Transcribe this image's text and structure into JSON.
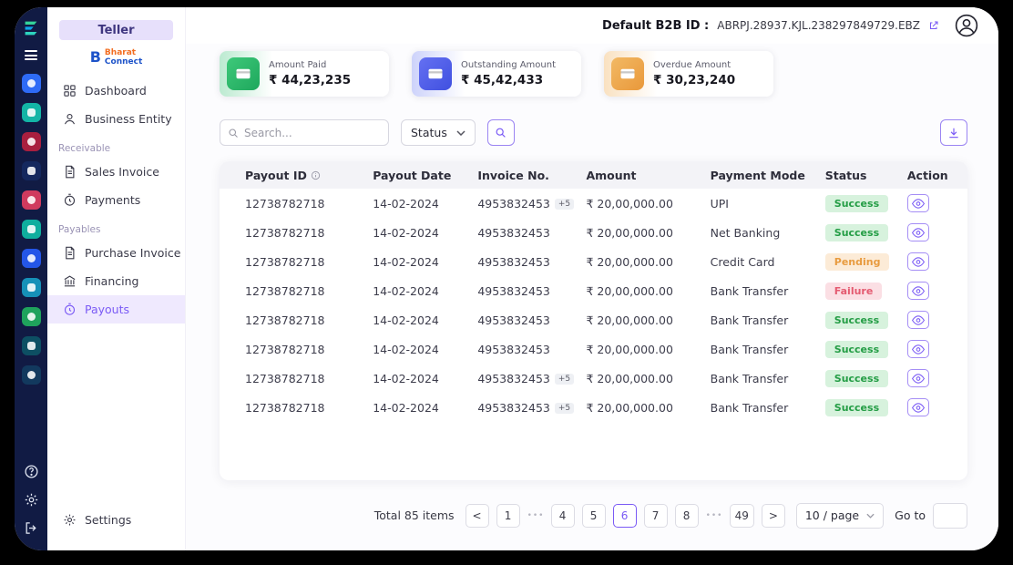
{
  "topbar": {
    "b2b_label": "Default B2B ID :",
    "b2b_value": "ABRPJ.28937.KJL.238297849729.EBZ"
  },
  "sidebar": {
    "title": "Teller",
    "brand_mark": "B",
    "brand_line1": "Bharat",
    "brand_line2": "Connect",
    "section_receivable": "Receivable",
    "section_payables": "Payables",
    "items": {
      "dashboard": "Dashboard",
      "business_entity": "Business Entity",
      "sales_invoice": "Sales Invoice",
      "payments": "Payments",
      "purchase_invoice": "Purchase Invoice",
      "financing": "Financing",
      "payouts": "Payouts",
      "settings": "Settings"
    },
    "active_item": "Payouts"
  },
  "stats": [
    {
      "label": "Amount Paid",
      "value": "₹ 44,23,235",
      "accent": "#2fb56b"
    },
    {
      "label": "Outstanding Amount",
      "value": "₹ 45,42,433",
      "accent": "#5a64ee"
    },
    {
      "label": "Overdue Amount",
      "value": "₹ 30,23,240",
      "accent": "#eeb05e"
    }
  ],
  "filters": {
    "search_placeholder": "Search...",
    "status_label": "Status"
  },
  "table": {
    "headers": [
      "Payout ID",
      "Payout Date",
      "Invoice No.",
      "Amount",
      "Payment Mode",
      "Status",
      "Action"
    ],
    "rows": [
      {
        "payout_id": "12738782718",
        "payout_date": "14-02-2024",
        "invoice_no": "4953832453",
        "invoice_extra": "+5",
        "amount": "₹ 20,00,000.00",
        "payment_mode": "UPI",
        "status": "Success"
      },
      {
        "payout_id": "12738782718",
        "payout_date": "14-02-2024",
        "invoice_no": "4953832453",
        "invoice_extra": "",
        "amount": "₹ 20,00,000.00",
        "payment_mode": "Net Banking",
        "status": "Success"
      },
      {
        "payout_id": "12738782718",
        "payout_date": "14-02-2024",
        "invoice_no": "4953832453",
        "invoice_extra": "",
        "amount": "₹ 20,00,000.00",
        "payment_mode": "Credit Card",
        "status": "Pending"
      },
      {
        "payout_id": "12738782718",
        "payout_date": "14-02-2024",
        "invoice_no": "4953832453",
        "invoice_extra": "",
        "amount": "₹ 20,00,000.00",
        "payment_mode": "Bank Transfer",
        "status": "Failure"
      },
      {
        "payout_id": "12738782718",
        "payout_date": "14-02-2024",
        "invoice_no": "4953832453",
        "invoice_extra": "",
        "amount": "₹ 20,00,000.00",
        "payment_mode": "Bank Transfer",
        "status": "Success"
      },
      {
        "payout_id": "12738782718",
        "payout_date": "14-02-2024",
        "invoice_no": "4953832453",
        "invoice_extra": "",
        "amount": "₹ 20,00,000.00",
        "payment_mode": "Bank Transfer",
        "status": "Success"
      },
      {
        "payout_id": "12738782718",
        "payout_date": "14-02-2024",
        "invoice_no": "4953832453",
        "invoice_extra": "+5",
        "amount": "₹ 20,00,000.00",
        "payment_mode": "Bank Transfer",
        "status": "Success"
      },
      {
        "payout_id": "12738782718",
        "payout_date": "14-02-2024",
        "invoice_no": "4953832453",
        "invoice_extra": "+5",
        "amount": "₹ 20,00,000.00",
        "payment_mode": "Bank Transfer",
        "status": "Success"
      }
    ]
  },
  "pagination": {
    "total_label": "Total 85 items",
    "items": [
      {
        "type": "prev",
        "label": "<"
      },
      {
        "type": "page",
        "label": "1"
      },
      {
        "type": "ellipsis",
        "label": "•••"
      },
      {
        "type": "page",
        "label": "4"
      },
      {
        "type": "page",
        "label": "5"
      },
      {
        "type": "page",
        "label": "6",
        "active": true
      },
      {
        "type": "page",
        "label": "7"
      },
      {
        "type": "page",
        "label": "8"
      },
      {
        "type": "ellipsis",
        "label": "•••"
      },
      {
        "type": "page",
        "label": "49"
      },
      {
        "type": "next",
        "label": ">"
      }
    ],
    "page_size": "10 / page",
    "goto_label": "Go to"
  },
  "icons": {
    "stat_cards": "credit-card",
    "search": "magnifier",
    "status_dropdown": "chevron-down",
    "export": "download-arrow",
    "payout_id_header": "info-circle",
    "row_action": "eye",
    "b2b_link": "external-link",
    "user": "avatar-person",
    "rail_bottom": [
      "help-circle",
      "gear",
      "logout"
    ]
  },
  "colors": {
    "accent_purple": "#7a5af5",
    "rail_bg": "#111b44",
    "success_bg": "#d7f2dd",
    "success_text": "#249d45",
    "pending_bg": "#fcebd7",
    "pending_text": "#e89b3f",
    "failure_bg": "#fbdfe4",
    "failure_text": "#e45a70"
  }
}
